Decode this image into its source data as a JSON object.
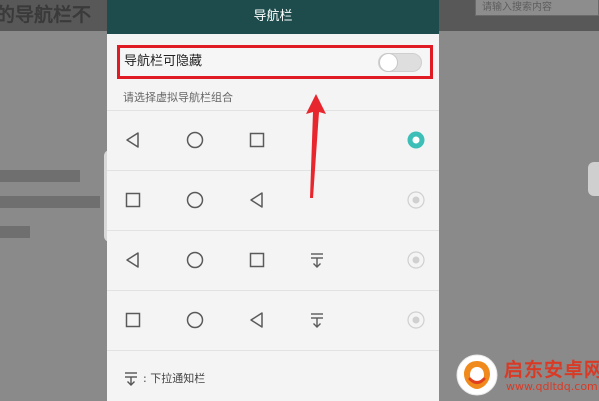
{
  "background": {
    "page_title": "的导航栏不",
    "search_placeholder": "请输入搜索内容"
  },
  "panel": {
    "header_title": "导航栏",
    "hide_toggle": {
      "label": "导航栏可隐藏",
      "enabled": false
    },
    "section_label": "请选择虚拟导航栏组合",
    "options": [
      {
        "keys": [
          "back-icon",
          "home-icon",
          "recent-icon"
        ],
        "selected": true
      },
      {
        "keys": [
          "recent-icon",
          "home-icon",
          "back-icon"
        ],
        "selected": false
      },
      {
        "keys": [
          "back-icon",
          "home-icon",
          "recent-icon",
          "notification-pulldown-icon"
        ],
        "selected": false
      },
      {
        "keys": [
          "recent-icon",
          "home-icon",
          "back-icon",
          "notification-pulldown-icon"
        ],
        "selected": false
      }
    ],
    "footer_legend": ": 下拉通知栏"
  },
  "watermark": {
    "name": "启东安卓网",
    "url": "www.qdltdq.com"
  },
  "colors": {
    "header": "#1e4c4c",
    "accent": "#3dbfb8",
    "highlight": "#e01b24"
  }
}
